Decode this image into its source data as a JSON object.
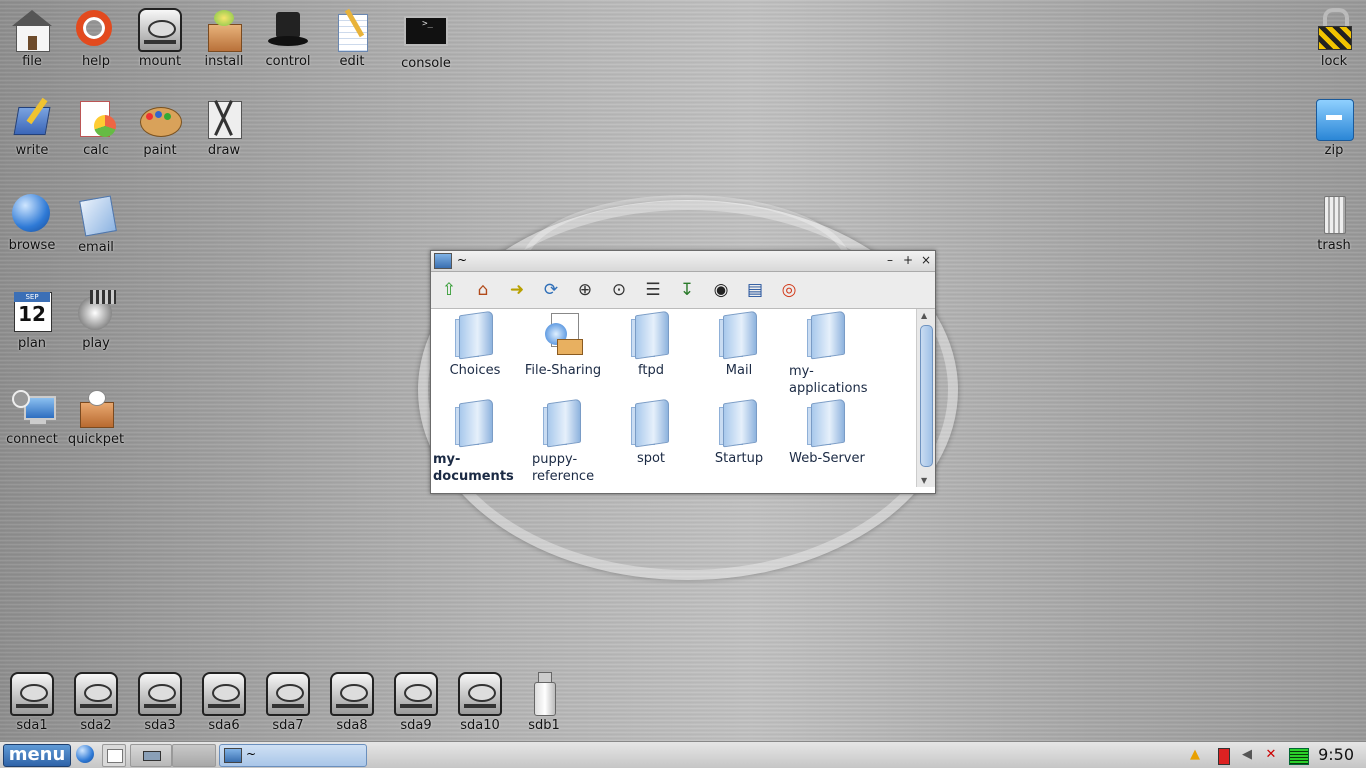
{
  "desktop": {
    "icons_left": [
      {
        "label": "file",
        "icon": "house-icon"
      },
      {
        "label": "help",
        "icon": "lifebuoy-icon"
      },
      {
        "label": "mount",
        "icon": "drive-icon"
      },
      {
        "label": "install",
        "icon": "package-icon"
      },
      {
        "label": "control",
        "icon": "top-hat-icon"
      },
      {
        "label": "edit",
        "icon": "notepad-icon"
      },
      {
        "label": "console",
        "icon": "terminal-icon"
      },
      {
        "label": "write",
        "icon": "pen-icon"
      },
      {
        "label": "calc",
        "icon": "calculator-icon"
      },
      {
        "label": "paint",
        "icon": "palette-icon"
      },
      {
        "label": "draw",
        "icon": "compass-icon"
      },
      {
        "label": "browse",
        "icon": "globe-icon"
      },
      {
        "label": "email",
        "icon": "mail-icon"
      },
      {
        "label": "plan",
        "icon": "calendar-icon",
        "calendar_month": "SEP",
        "calendar_day": "12"
      },
      {
        "label": "play",
        "icon": "speaker-icon"
      },
      {
        "label": "connect",
        "icon": "network-icon"
      },
      {
        "label": "quickpet",
        "icon": "puppy-box-icon"
      }
    ],
    "icons_right": [
      {
        "label": "lock",
        "icon": "padlock-icon"
      },
      {
        "label": "zip",
        "icon": "archive-icon"
      },
      {
        "label": "trash",
        "icon": "trash-icon"
      }
    ],
    "drives": [
      {
        "label": "sda1"
      },
      {
        "label": "sda2"
      },
      {
        "label": "sda3"
      },
      {
        "label": "sda6"
      },
      {
        "label": "sda7"
      },
      {
        "label": "sda8"
      },
      {
        "label": "sda9"
      },
      {
        "label": "sda10"
      },
      {
        "label": "sdb1"
      }
    ]
  },
  "file_window": {
    "title": "~",
    "controls": {
      "minimize": "–",
      "maximize": "+",
      "close": "×"
    },
    "toolbar": [
      {
        "icon": "up-arrow-icon",
        "glyph": "⇧"
      },
      {
        "icon": "home-icon",
        "glyph": "⌂"
      },
      {
        "icon": "go-icon",
        "glyph": "➜"
      },
      {
        "icon": "refresh-icon",
        "glyph": "⟳"
      },
      {
        "icon": "zoom-in-icon",
        "glyph": "⊕"
      },
      {
        "icon": "zoom-fit-icon",
        "glyph": "⊙"
      },
      {
        "icon": "details-view-icon",
        "glyph": "☰"
      },
      {
        "icon": "sort-az-icon",
        "glyph": "↧"
      },
      {
        "icon": "show-hidden-eye-icon",
        "glyph": "◉"
      },
      {
        "icon": "list-view-icon",
        "glyph": "▤"
      },
      {
        "icon": "help-lifebuoy-icon",
        "glyph": "◎"
      }
    ],
    "items": [
      {
        "name": "Choices",
        "label_line1": "Choices",
        "label_line2": "",
        "type": "folder"
      },
      {
        "name": "File-Sharing",
        "label_line1": "File-Sharing",
        "label_line2": "",
        "type": "app"
      },
      {
        "name": "ftpd",
        "label_line1": "ftpd",
        "label_line2": "",
        "type": "folder"
      },
      {
        "name": "Mail",
        "label_line1": "Mail",
        "label_line2": "",
        "type": "folder"
      },
      {
        "name": "my-applications",
        "label_line1": "my-",
        "label_line2": "applications",
        "type": "folder"
      },
      {
        "name": "my-documents",
        "label_line1": "my-",
        "label_line2": "documents",
        "type": "folder",
        "selected": true
      },
      {
        "name": "puppy-reference",
        "label_line1": "puppy-",
        "label_line2": "reference",
        "type": "folder"
      },
      {
        "name": "spot",
        "label_line1": "spot",
        "label_line2": "",
        "type": "folder"
      },
      {
        "name": "Startup",
        "label_line1": "Startup",
        "label_line2": "",
        "type": "folder"
      },
      {
        "name": "Web-Server",
        "label_line1": "Web-Server",
        "label_line2": "",
        "type": "folder"
      }
    ]
  },
  "taskbar": {
    "menu_label": "menu",
    "task_title": "~",
    "clock": "9:50",
    "tray_icons": [
      "warning-icon",
      "battery-icon",
      "volume-icon",
      "network-disconnected-icon",
      "cpu-meter-icon"
    ]
  },
  "colors": {
    "menu_button": "#2f63a8",
    "selected_item_text": "#1b2a44",
    "folder": "#a9c9ec"
  }
}
